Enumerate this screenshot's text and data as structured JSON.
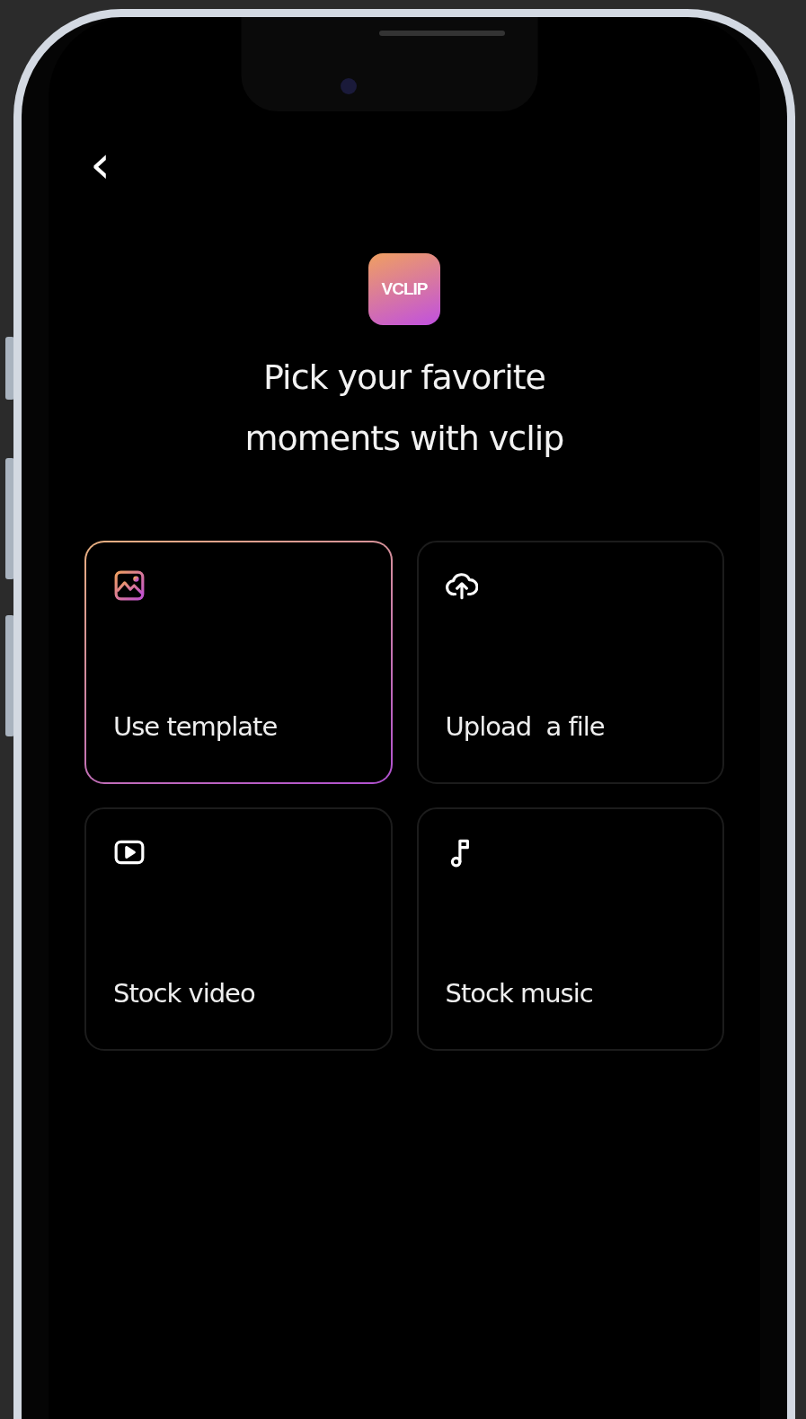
{
  "screen": {
    "back": "‹",
    "logo": "VCLIP",
    "title": "Pick your favorite moments with vclip"
  },
  "options": [
    {
      "kind": "template",
      "label": "Use template",
      "selected": true
    },
    {
      "kind": "upload",
      "label": "Upload  a file",
      "selected": false
    },
    {
      "kind": "video",
      "label": "Stock video",
      "selected": false
    },
    {
      "kind": "music",
      "label": "Stock music",
      "selected": false
    }
  ]
}
